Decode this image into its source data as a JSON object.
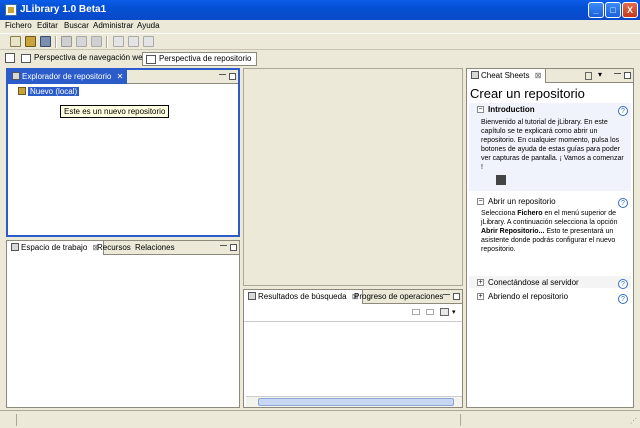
{
  "window": {
    "title": "JLibrary 1.0 Beta1",
    "minimize": "_",
    "maximize": "□",
    "close": "X"
  },
  "menu": [
    "Fichero",
    "Editar",
    "Buscar",
    "Administrar",
    "Ayuda"
  ],
  "perspectives": {
    "web": "Perspectiva de navegación web",
    "repo": "Perspectiva de repositorio"
  },
  "explorer": {
    "tab": "Explorador de repositorio",
    "tab_close": "✕",
    "node_label": "Nuevo (local)",
    "tooltip": "Este es un nuevo repositorio"
  },
  "workspace_tabs": [
    "Espacio de trabajo",
    "Recursos",
    "Relaciones"
  ],
  "bottom_tabs": [
    "Resultados de búsqueda",
    "Progreso de operaciones"
  ],
  "cheat_sheets": {
    "tab": "Cheat Sheets",
    "title": "Crear un repositorio",
    "intro": {
      "header": "Introduction",
      "text": "Bienvenido al tutorial de jLibrary. En este capítulo se te explicará como abrir un repositorio. En cualquier momento, pulsa los botones de ayuda de estas guías para poder ver capturas de pantalla. ¡ Vamos a comenzar !"
    },
    "step1": {
      "header": "Abrir un repositorio",
      "text_a": "Selecciona ",
      "text_b": "Fichero",
      "text_c": " en el menú superior de jLibrary. A continuación selecciona la opción ",
      "text_d": "Abrir Repositorio...",
      "text_e": " Esto te presentará un asistente donde podrás configurar el nuevo repositorio."
    },
    "step2": {
      "header": "Conectándose al servidor"
    },
    "step3": {
      "header": "Abriendo el repositorio"
    },
    "help_glyph": "?",
    "collapse_glyph": "−",
    "expand_glyph": "+"
  },
  "colors": {
    "title_bar": "#0a5ce9",
    "selection": "#2b5cc9",
    "tooltip_bg": "#ffffe1",
    "panel_border": "#8d8a7d"
  }
}
